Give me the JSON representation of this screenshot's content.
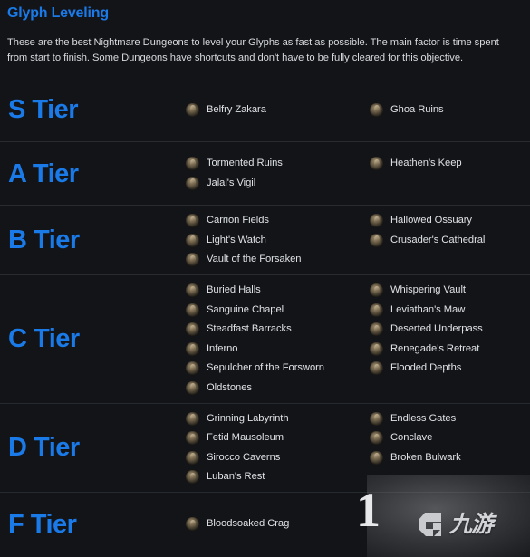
{
  "header": {
    "title": "Glyph Leveling",
    "description": "These are the best Nightmare Dungeons to level your Glyphs as fast as possible. The main factor is time spent from start to finish. Some Dungeons have shortcuts and don't have to be fully cleared for this objective."
  },
  "colors": {
    "accent_blue": "#1a7ae8",
    "background": "#131418",
    "divider": "#272a2e",
    "text_primary": "#dfe2e6"
  },
  "tiers": [
    {
      "label": "S Tier",
      "left": [
        "Belfry Zakara"
      ],
      "right": [
        "Ghoa Ruins"
      ]
    },
    {
      "label": "A Tier",
      "left": [
        "Tormented Ruins",
        "Jalal's Vigil"
      ],
      "right": [
        "Heathen's Keep"
      ]
    },
    {
      "label": "B Tier",
      "left": [
        "Carrion Fields",
        "Light's Watch",
        "Vault of the Forsaken"
      ],
      "right": [
        "Hallowed Ossuary",
        "Crusader's Cathedral"
      ]
    },
    {
      "label": "C Tier",
      "left": [
        "Buried Halls",
        "Sanguine Chapel",
        "Steadfast Barracks",
        "Inferno",
        "Sepulcher of the Forsworn",
        "Oldstones"
      ],
      "right": [
        "Whispering Vault",
        "Leviathan's Maw",
        "Deserted Underpass",
        "Renegade's Retreat",
        "Flooded Depths"
      ]
    },
    {
      "label": "D Tier",
      "left": [
        "Grinning Labyrinth",
        "Fetid Mausoleum",
        "Sirocco Caverns",
        "Luban's Rest"
      ],
      "right": [
        "Endless Gates",
        "Conclave",
        "Broken Bulwark"
      ]
    },
    {
      "label": "F Tier",
      "left": [
        "Bloodsoaked Crag"
      ],
      "right": []
    }
  ],
  "watermark": {
    "text": "九游",
    "numeral": "1"
  }
}
